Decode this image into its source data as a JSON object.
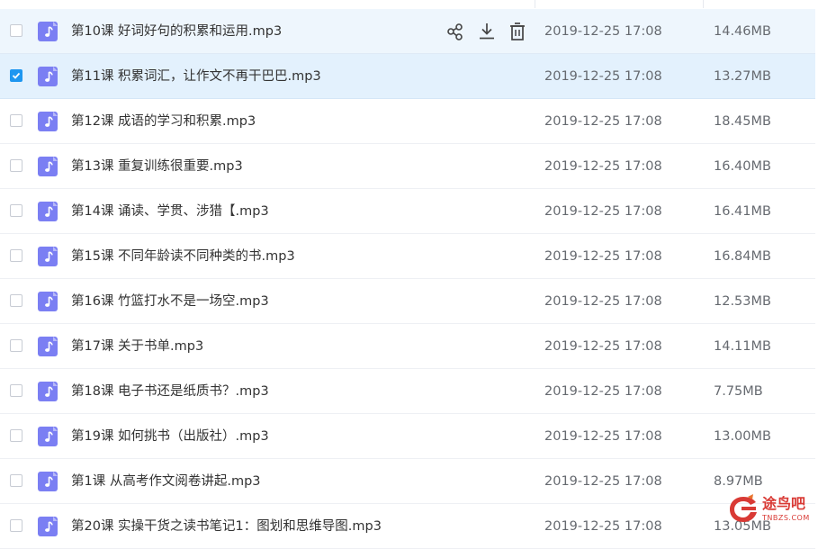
{
  "file_list": {
    "rows": [
      {
        "name": "第10课 好词好句的积累和运用.mp3",
        "date": "2019-12-25 17:08",
        "size": "14.46MB",
        "checked": false,
        "state": "hovered"
      },
      {
        "name": "第11课 积累词汇，让作文不再干巴巴.mp3",
        "date": "2019-12-25 17:08",
        "size": "13.27MB",
        "checked": true,
        "state": "selected"
      },
      {
        "name": "第12课 成语的学习和积累.mp3",
        "date": "2019-12-25 17:08",
        "size": "18.45MB",
        "checked": false,
        "state": "normal"
      },
      {
        "name": "第13课 重复训练很重要.mp3",
        "date": "2019-12-25 17:08",
        "size": "16.40MB",
        "checked": false,
        "state": "normal"
      },
      {
        "name": "第14课 诵读、学贯、涉猎【.mp3",
        "date": "2019-12-25 17:08",
        "size": "16.41MB",
        "checked": false,
        "state": "normal"
      },
      {
        "name": "第15课 不同年龄读不同种类的书.mp3",
        "date": "2019-12-25 17:08",
        "size": "16.84MB",
        "checked": false,
        "state": "normal"
      },
      {
        "name": "第16课 竹篮打水不是一场空.mp3",
        "date": "2019-12-25 17:08",
        "size": "12.53MB",
        "checked": false,
        "state": "normal"
      },
      {
        "name": "第17课 关于书单.mp3",
        "date": "2019-12-25 17:08",
        "size": "14.11MB",
        "checked": false,
        "state": "normal"
      },
      {
        "name": "第18课 电子书还是纸质书？.mp3",
        "date": "2019-12-25 17:08",
        "size": "7.75MB",
        "checked": false,
        "state": "normal"
      },
      {
        "name": "第19课 如何挑书（出版社）.mp3",
        "date": "2019-12-25 17:08",
        "size": "13.00MB",
        "checked": false,
        "state": "normal"
      },
      {
        "name": "第1课 从高考作文阅卷讲起.mp3",
        "date": "2019-12-25 17:08",
        "size": "8.97MB",
        "checked": false,
        "state": "normal"
      },
      {
        "name": "第20课 实操干货之读书笔记1：图划和思维导图.mp3",
        "date": "2019-12-25 17:08",
        "size": "13.05MB",
        "checked": false,
        "state": "normal"
      }
    ],
    "hover_actions": [
      {
        "icon": "share-icon"
      },
      {
        "icon": "download-icon"
      },
      {
        "icon": "delete-icon"
      }
    ],
    "file_icon": "audio-file-icon"
  },
  "watermark": {
    "title": "途鸟吧",
    "subtitle": "TNBZS.COM"
  },
  "colors": {
    "accent": "#1e96f0",
    "file_icon_bg": "#7b7ff3",
    "hover_row": "#eef6fd",
    "selected_row": "#e3f1fd",
    "text": "#333333",
    "meta_text": "#666a70",
    "watermark": "#d93a35"
  }
}
